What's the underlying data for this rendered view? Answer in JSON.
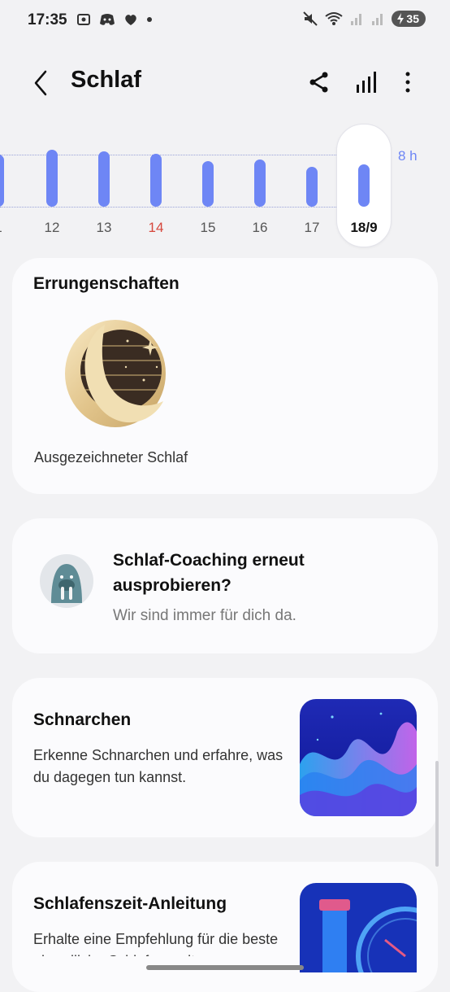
{
  "status": {
    "time": "17:35",
    "battery": "35"
  },
  "header": {
    "title": "Schlaf"
  },
  "chart_data": {
    "type": "bar",
    "categories": [
      "1",
      "12",
      "13",
      "14",
      "15",
      "16",
      "17",
      "18/9"
    ],
    "values": [
      8.0,
      8.7,
      8.5,
      8.1,
      7.0,
      7.2,
      6.1,
      6.5
    ],
    "highlight_red": "14",
    "selected": "18/9",
    "reference_label": "8 h",
    "reference_value": 8,
    "ylim": [
      0,
      9
    ],
    "color": "#6e86f5"
  },
  "achievements": {
    "title": "Errungenschaften",
    "badge_label": "Ausgezeichneter Schlaf"
  },
  "coaching": {
    "title": "Schlaf-Coaching erneut ausprobieren?",
    "subtitle": "Wir sind immer für dich da."
  },
  "snoring": {
    "title": "Schnarchen",
    "description": "Erkenne Schnarchen und erfahre, was du dagegen tun kannst."
  },
  "bedtime": {
    "title": "Schlafenszeit-Anleitung",
    "description": "Erhalte eine Empfehlung für die beste abendliche Schlafenszeit, um"
  }
}
